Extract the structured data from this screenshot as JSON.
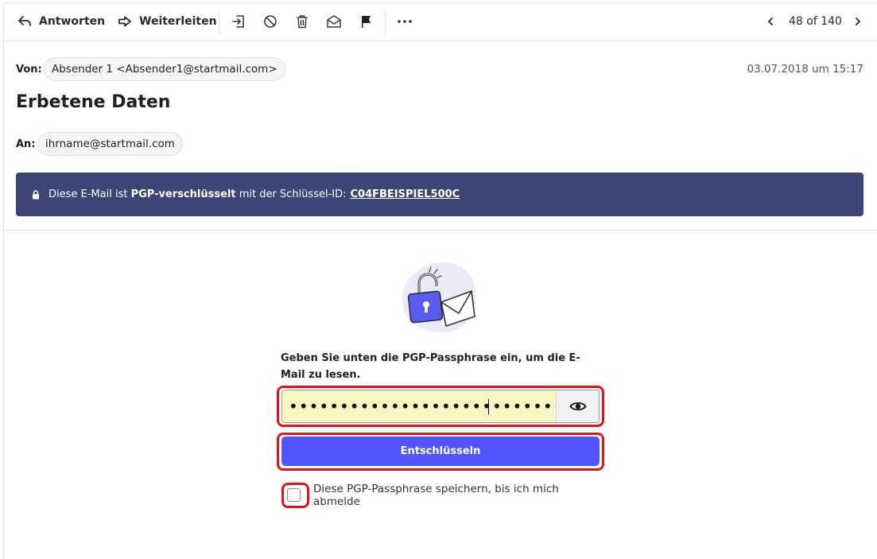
{
  "toolbar": {
    "reply_label": "Antworten",
    "forward_label": "Weiterleiten",
    "pager_text": "48 of 140"
  },
  "header": {
    "from_label": "Von:",
    "from_value": "Absender 1 <Absender1@startmail.com>",
    "date": "03.07.2018 um 15:17",
    "subject": "Erbetene Daten",
    "to_label": "An:",
    "to_value": "ihrname@startmail.com"
  },
  "banner": {
    "text_before": "Diese E-Mail ist ",
    "text_bold": "PGP-verschlüsselt",
    "text_after": " mit der Schlüssel-ID:",
    "key_id": "C04FBEISPIEL500C",
    "background": "#3b4677"
  },
  "decrypt": {
    "instruction": "Geben Sie unten die PGP-Passphrase ein, um die E-Mail zu lesen.",
    "passphrase_masked": "•••••••••••••••••••••••••••",
    "button_label": "Entschlüsseln",
    "remember_label": "Diese PGP-Passphrase speichern, bis ich mich abmelde",
    "remember_checked": false,
    "button_color": "#4f56ff",
    "highlight_color": "#e8101a"
  },
  "icons": {
    "reply": "reply-icon",
    "forward": "forward-icon",
    "move": "move-to-folder-icon",
    "spam": "block-icon",
    "delete": "trash-icon",
    "unread": "open-envelope-icon",
    "flag": "flag-icon",
    "more": "more-icon",
    "prev": "chevron-left-icon",
    "next": "chevron-right-icon",
    "lock": "lock-icon",
    "show_password": "eye-icon"
  }
}
